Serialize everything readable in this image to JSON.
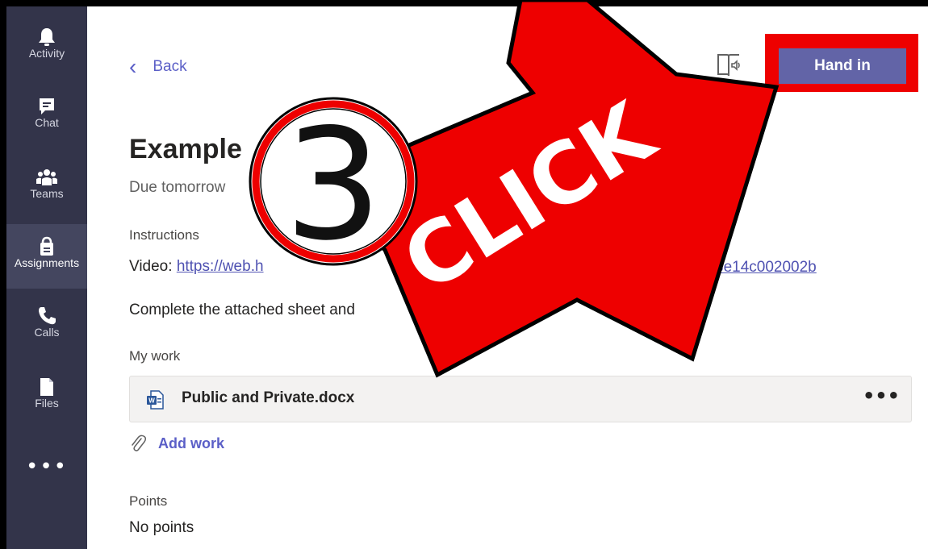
{
  "rail": {
    "items": [
      {
        "label": "Activity",
        "icon": "bell-icon"
      },
      {
        "label": "Chat",
        "icon": "chat-icon"
      },
      {
        "label": "Teams",
        "icon": "teams-icon"
      },
      {
        "label": "Assignments",
        "icon": "assignments-icon"
      },
      {
        "label": "Calls",
        "icon": "phone-icon"
      },
      {
        "label": "Files",
        "icon": "files-icon"
      }
    ],
    "more": "•••"
  },
  "header": {
    "back_label": "Back",
    "hand_in_label": "Hand in"
  },
  "assignment": {
    "title": "Example",
    "due": "Due tomorrow",
    "instructions_label": "Instructions",
    "video_prefix": "Video: ",
    "video_link_start": "https://web.h",
    "video_link_end": "3e14c002002b",
    "note": "Complete the attached sheet and",
    "my_work_label": "My work",
    "file_name": "Public and Private.docx",
    "file_more": "•••",
    "add_work_label": "Add work",
    "points_label": "Points",
    "points_value": "No points"
  },
  "annotation": {
    "step_number": "3",
    "arrow_text": "CLICK",
    "arrow_color": "#ee0000",
    "highlight_color": "#ee0000"
  },
  "colors": {
    "rail_bg": "#33344a",
    "accent": "#6264a7",
    "link": "#4f52b2"
  }
}
